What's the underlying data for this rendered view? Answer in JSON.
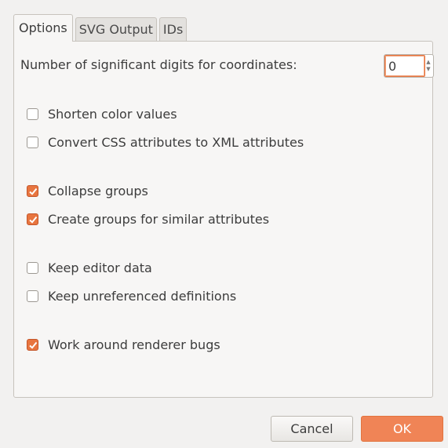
{
  "tabs": [
    {
      "label": "Options",
      "active": true
    },
    {
      "label": "SVG Output",
      "active": false
    },
    {
      "label": "IDs",
      "active": false
    }
  ],
  "digits": {
    "label": "Number of significant digits for coordinates:",
    "value": "0"
  },
  "options": [
    {
      "label": "Shorten color values",
      "checked": false
    },
    {
      "label": "Convert CSS attributes to XML attributes",
      "checked": false
    },
    {
      "label": "Collapse groups",
      "checked": true
    },
    {
      "label": "Create groups for similar attributes",
      "checked": true
    },
    {
      "label": "Keep editor data",
      "checked": false
    },
    {
      "label": "Keep unreferenced definitions",
      "checked": false
    },
    {
      "label": "Work around renderer bugs",
      "checked": true
    }
  ],
  "buttons": {
    "cancel": "Cancel",
    "ok": "OK"
  },
  "colors": {
    "accent": "#e8753f",
    "ok_button": "#f08456"
  }
}
